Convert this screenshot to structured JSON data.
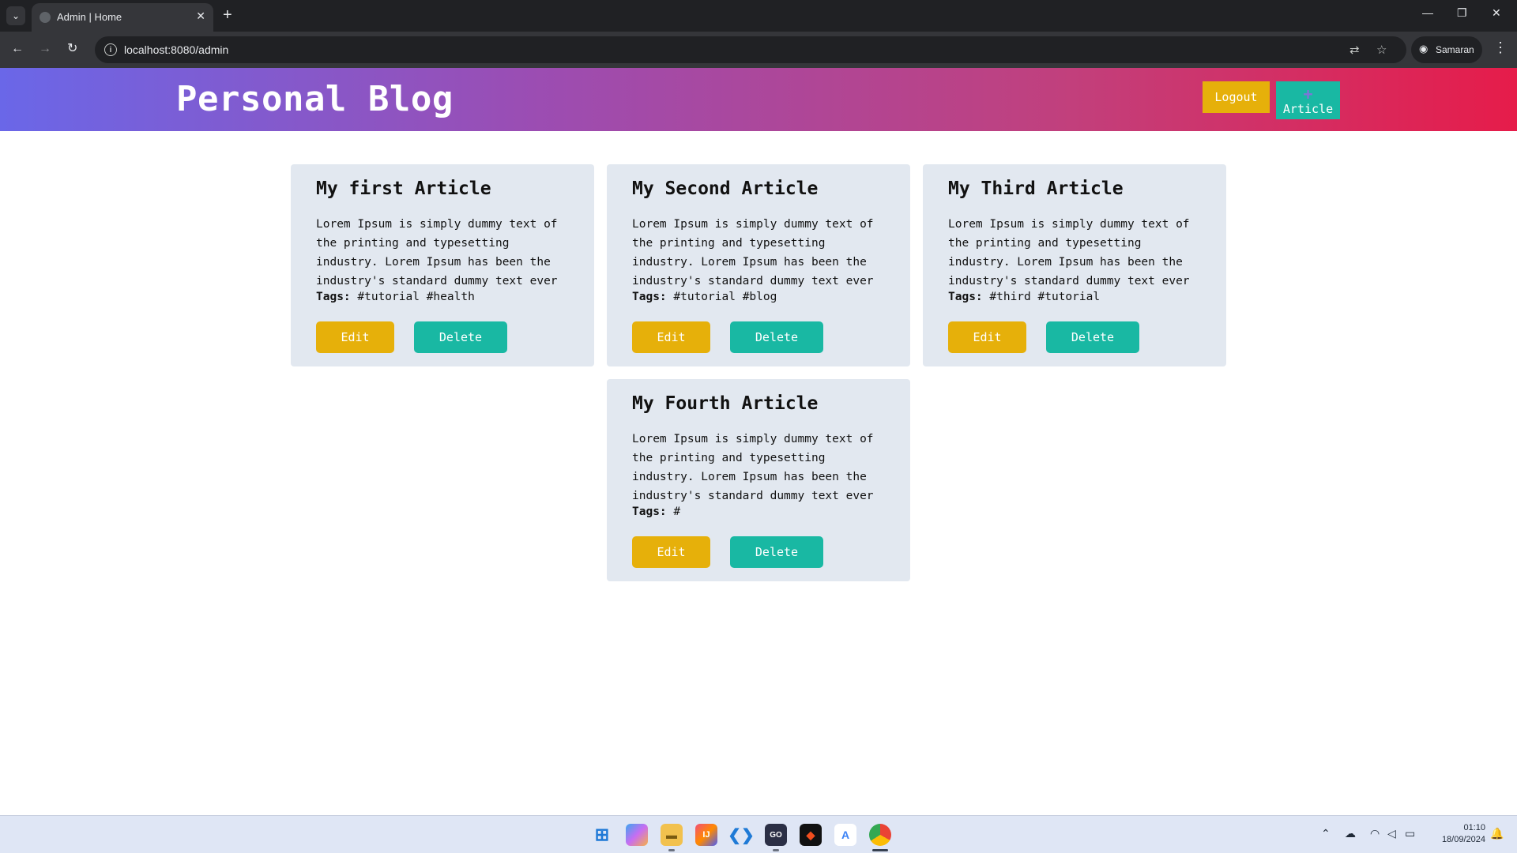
{
  "browser": {
    "tab_title": "Admin | Home",
    "url": "localhost:8080/admin",
    "profile_name": "Samaran"
  },
  "header": {
    "site_title": "Personal Blog",
    "logout_label": "Logout",
    "add_plus": "+",
    "add_label": "Article"
  },
  "articles": [
    {
      "title": "My first Article",
      "body": "Lorem Ipsum is simply dummy text of the printing and typesetting industry. Lorem Ipsum has been the industry's standard dummy text ever",
      "tags_label": "Tags:",
      "tags": "#tutorial #health",
      "edit_label": "Edit",
      "delete_label": "Delete"
    },
    {
      "title": "My Second Article",
      "body": "Lorem Ipsum is simply dummy text of the printing and typesetting industry. Lorem Ipsum has been the industry's standard dummy text ever",
      "tags_label": "Tags:",
      "tags": "#tutorial #blog",
      "edit_label": "Edit",
      "delete_label": "Delete"
    },
    {
      "title": "My Third Article",
      "body": "Lorem Ipsum is simply dummy text of the printing and typesetting industry. Lorem Ipsum has been the industry's standard dummy text ever",
      "tags_label": "Tags:",
      "tags": "#third #tutorial",
      "edit_label": "Edit",
      "delete_label": "Delete"
    },
    {
      "title": "My Fourth Article",
      "body": "Lorem Ipsum is simply dummy text of the printing and typesetting industry. Lorem Ipsum has been the industry's standard dummy text ever",
      "tags_label": "Tags:",
      "tags": "#",
      "edit_label": "Edit",
      "delete_label": "Delete"
    }
  ],
  "taskbar": {
    "time": "01:10",
    "date": "18/09/2024"
  },
  "colors": {
    "header_gradient_start": "#6a67e8",
    "header_gradient_end": "#e61c4a",
    "edit_button": "#e6b00a",
    "delete_button": "#19b8a3",
    "card_background": "#e2e8f0"
  }
}
